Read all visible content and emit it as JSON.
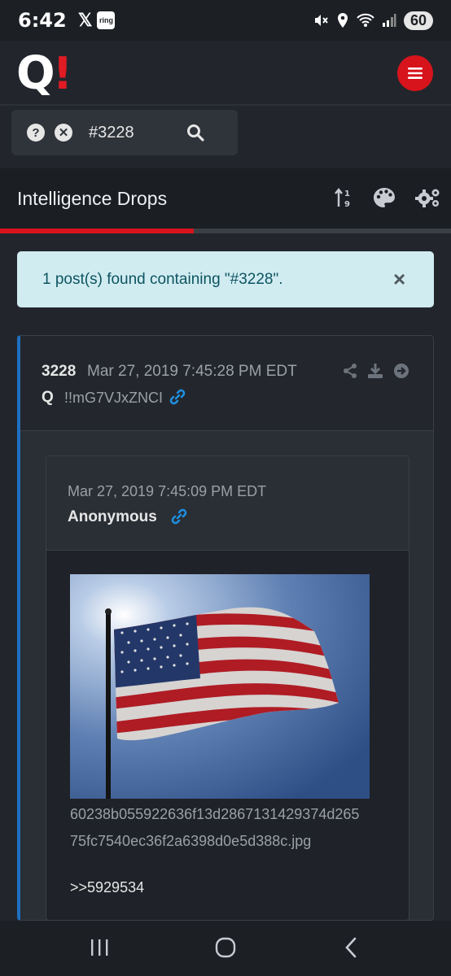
{
  "status_bar": {
    "time": "6:42",
    "x_label": "𝕏",
    "ring_label": "ring",
    "battery": "60"
  },
  "header": {
    "logo_letter": "Q",
    "logo_mark": "!"
  },
  "search": {
    "value": "#3228"
  },
  "section": {
    "title": "Intelligence Drops",
    "progress_fraction": 0.43
  },
  "alert": {
    "message": "1 post(s) found containing \"#3228\".",
    "close_label": "×"
  },
  "post": {
    "number": "3228",
    "date": "Mar 27, 2019 7:45:28 PM EDT",
    "author": "Q",
    "tripcode": "!!mG7VJxZNCI",
    "quoted": {
      "date": "Mar 27, 2019 7:45:09 PM EDT",
      "author": "Anonymous",
      "filename_line1": "60238b055922636f13d2867131429374d265",
      "filename_line2": "75fc7540ec36f2a6398d0e5d388c.jpg",
      "reply_ref": ">>5929534"
    }
  },
  "colors": {
    "accent_red": "#d7141c",
    "link_blue": "#1f8fe0",
    "alert_bg": "#d1ecf1",
    "alert_text": "#0c5460"
  },
  "icons": [
    "help-icon",
    "clear-icon",
    "search-icon",
    "menu-icon",
    "sort-icon",
    "palette-icon",
    "settings-icon",
    "share-icon",
    "download-icon",
    "goto-icon",
    "link-icon"
  ]
}
